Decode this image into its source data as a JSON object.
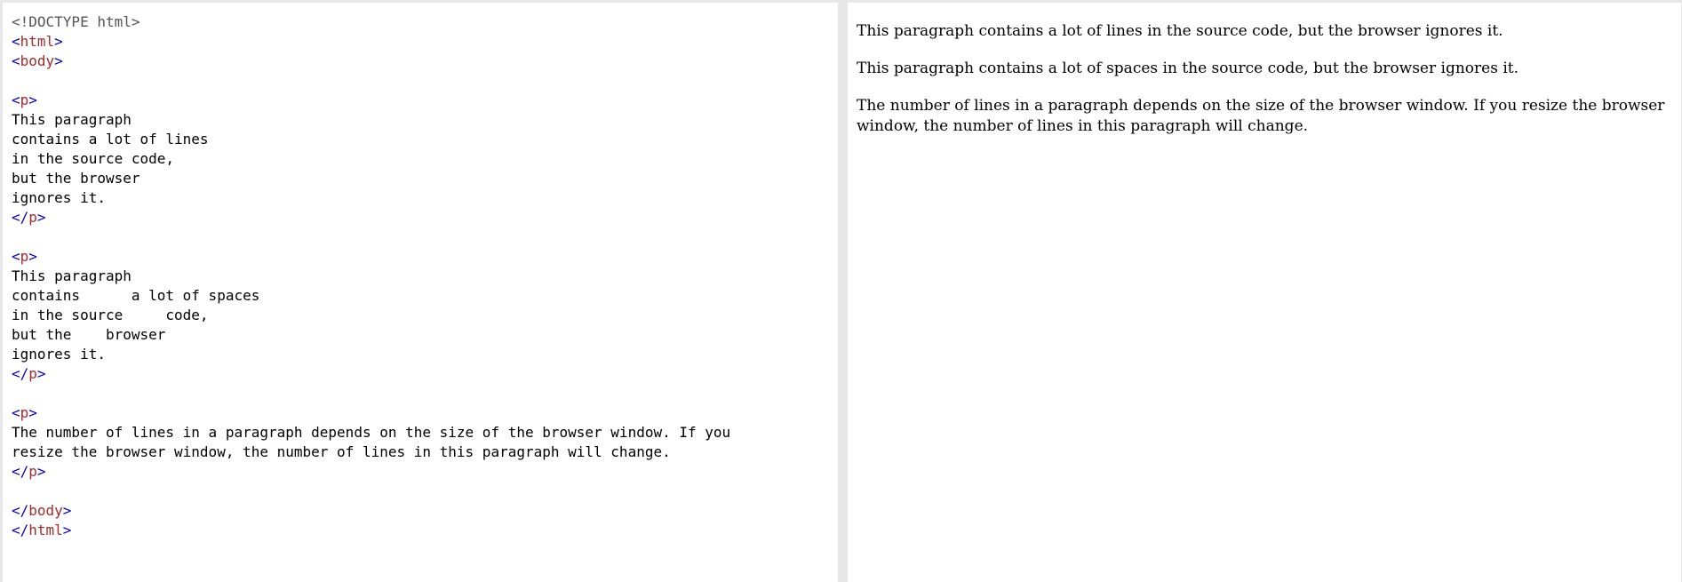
{
  "colors": {
    "bracket": "#0000cd",
    "tagname": "#a52a2a",
    "doctype": "#555555",
    "text": "#000000",
    "background": "#ffffff",
    "divider": "#e7e7e7"
  },
  "code": {
    "doctype": "<!DOCTYPE html>",
    "html_tag": "html",
    "body_tag": "body",
    "p_tag": "p",
    "lt": "<",
    "gt": ">",
    "lt_close": "</",
    "para1_lines": [
      "This paragraph",
      "contains a lot of lines",
      "in the source code,",
      "but the browser",
      "ignores it."
    ],
    "para2_lines": [
      "This paragraph",
      "contains      a lot of spaces",
      "in the source     code,",
      "but the    browser",
      "ignores it."
    ],
    "para3_lines": [
      "The number of lines in a paragraph depends on the size of the browser window. If you",
      "resize the browser window, the number of lines in this paragraph will change."
    ]
  },
  "result": {
    "paragraphs": [
      "This paragraph contains a lot of lines in the source code, but the browser ignores it.",
      "This paragraph contains a lot of spaces in the source code, but the browser ignores it.",
      "The number of lines in a paragraph depends on the size of the browser window. If you resize the browser window, the number of lines in this paragraph will change."
    ]
  }
}
